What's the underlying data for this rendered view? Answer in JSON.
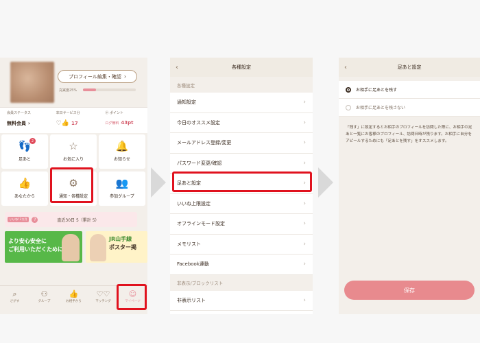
{
  "screen1": {
    "profile_button": "プロフィール編集・確認",
    "fill_label": "充実度25%",
    "fill_fraction": 0.25,
    "status": {
      "member_label": "会員ステータス",
      "member_value": "無料会員",
      "service_label": "本日サービス分",
      "service_value": "17",
      "points_label": "ポイント",
      "points_tag": "ログ無料",
      "points_value": "43pt"
    },
    "grid": [
      {
        "label": "足あと",
        "icon": "footprints-icon",
        "badge": "2"
      },
      {
        "label": "お気に入り",
        "icon": "star-icon"
      },
      {
        "label": "お知らせ",
        "icon": "bell-icon"
      },
      {
        "label": "あなたから",
        "icon": "thumbs-up-icon"
      },
      {
        "label": "通知・各種設定",
        "icon": "gear-icon"
      },
      {
        "label": "参加グループ",
        "icon": "group-icon"
      }
    ],
    "likes": {
      "tag": "いいね! 2カ月",
      "text": "直近30日 5（累計 5）"
    },
    "banner1": {
      "line1": "より安心",
      "line2": "安全に",
      "line3": "ご利用いただくために"
    },
    "banner2": {
      "line1": "JR山手線",
      "line2": "ポスター掲"
    },
    "tabs": [
      {
        "label": "さがす",
        "icon": "search-icon"
      },
      {
        "label": "グループ",
        "icon": "group-icon"
      },
      {
        "label": "お相手から",
        "icon": "thumbs-up-icon"
      },
      {
        "label": "マッチング",
        "icon": "hearts-icon"
      },
      {
        "label": "マイページ",
        "icon": "person-icon",
        "badge": "●"
      }
    ]
  },
  "screen2": {
    "title": "各種設定",
    "section1": "各種設定",
    "rows": [
      "通知設定",
      "今日のオススメ設定",
      "メールアドレス登録/変更",
      "パスワード変更/確認",
      "足あと設定",
      "いいね上限設定",
      "オフラインモード設定",
      "メモリスト",
      "Facebook連動"
    ],
    "section2": "非表示/ブロックリスト",
    "rows2": [
      "非表示リスト"
    ]
  },
  "screen3": {
    "title": "足あと設定",
    "option_on": "お相手に足あとを残す",
    "option_off": "お相手に足あとを残さない",
    "description": "「残す」に設定するとお相手のプロフィールを訪問した際に、お相手の足あと一覧にお客様のプロフィール、訪問日時が残ります。お相手に自分をアピールするためにも「足あとを残す」をオススメします。",
    "save_label": "保存"
  },
  "colors": {
    "highlight": "#e0121e",
    "accent_pink": "#e88a8e",
    "banner_green": "#57b848"
  }
}
